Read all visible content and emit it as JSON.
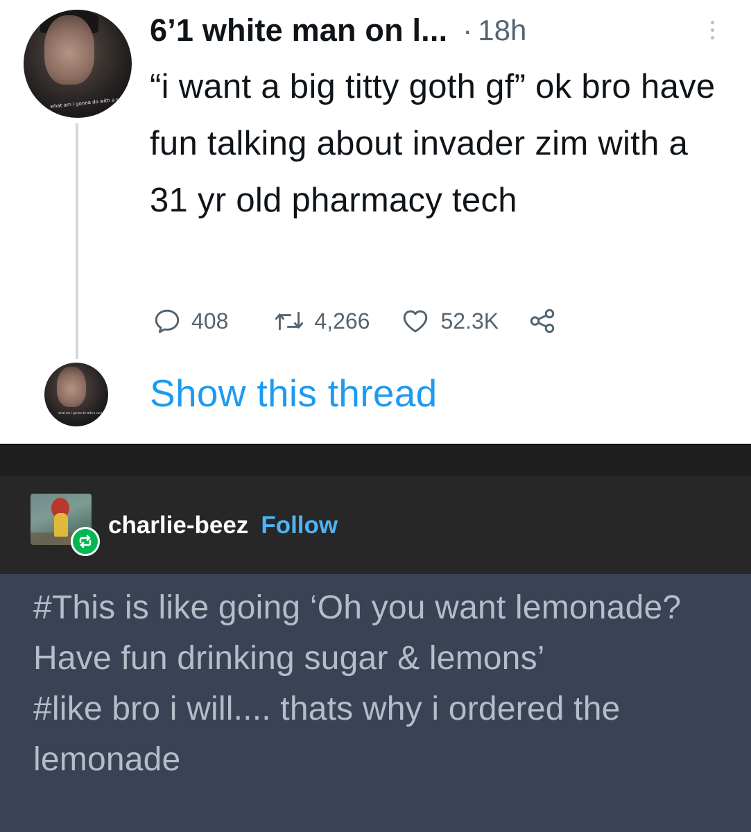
{
  "tweet": {
    "author": "6’1 white man on l...",
    "separator": "·",
    "time": "18h",
    "text": "“i want a big titty goth gf” ok bro have fun talking about invader zim with a 31 yr old pharmacy tech",
    "avatar_caption": "what am i gonna do with a soul anyways?",
    "replies": "408",
    "retweets": "4,266",
    "likes": "52.3K",
    "show_thread": "Show this thread"
  },
  "post": {
    "username": "charlie-beez",
    "follow_label": "Follow"
  },
  "tags": [
    "#This is like going ‘Oh you want lemonade? Have fun drinking sugar & lemons’",
    "#like bro i will.... thats why i ordered the lemonade"
  ],
  "colors": {
    "link_blue": "#1d9bf0",
    "follow_blue": "#4cb3f5",
    "tags_background": "#3a4356",
    "reblog_green": "#00b852"
  },
  "icons": {
    "more": "more-icon",
    "reply": "reply-icon",
    "retweet": "retweet-icon",
    "like": "heart-icon",
    "share": "share-icon",
    "reblog": "reblog-icon"
  }
}
